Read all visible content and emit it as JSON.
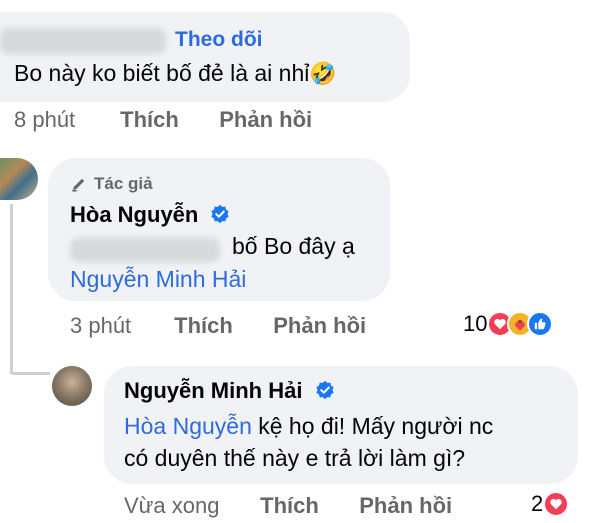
{
  "comment1": {
    "follow_label": "Theo dõi",
    "text": "Bo này ko biết bố đẻ là ai nhỉ",
    "emoji": "🤣",
    "time": "8 phút",
    "like": "Thích",
    "reply": "Phản hồi"
  },
  "comment2": {
    "author_badge": "Tác giả",
    "author": "Hòa Nguyễn",
    "text": "bố Bo đây ạ",
    "mention": "Nguyễn Minh Hải",
    "time": "3 phút",
    "like": "Thích",
    "reply": "Phản hồi",
    "reaction_count": "10",
    "reactions": [
      "love-icon",
      "care-icon",
      "like-icon"
    ]
  },
  "comment3": {
    "author": "Nguyễn Minh Hải",
    "mention": "Hòa Nguyễn",
    "text_line1": "kệ họ đi! Mấy người nc",
    "text_line2": "có duyên thế này e trả lời làm gì?",
    "time": "Vừa xong",
    "like": "Thích",
    "reply": "Phản hồi",
    "reaction_count": "2",
    "reactions": [
      "love-icon"
    ]
  },
  "colors": {
    "link": "#2e6bdc",
    "bubble": "#f0f2f5",
    "meta": "#65676b",
    "love": "#f33e58",
    "like": "#1877f2",
    "verified": "#1877f2"
  }
}
